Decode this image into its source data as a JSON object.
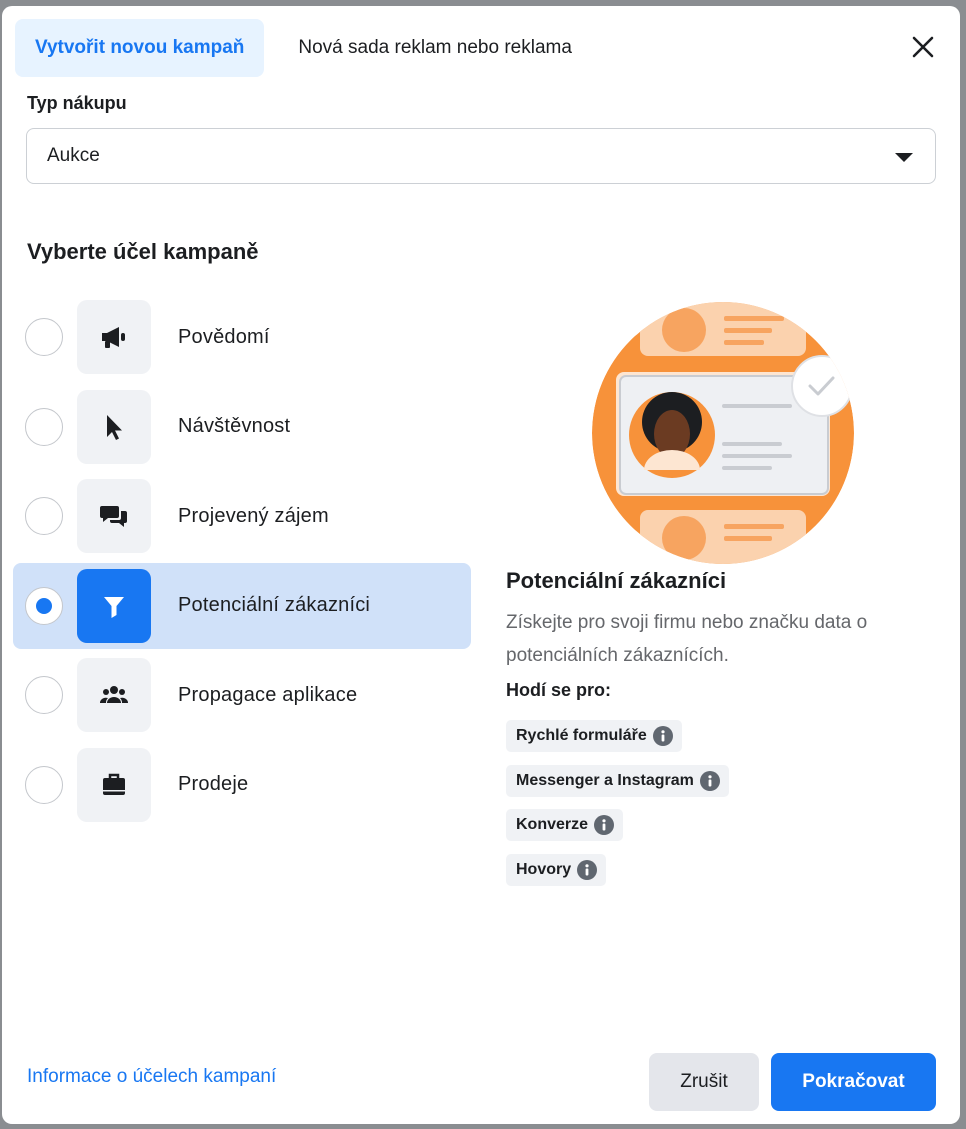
{
  "tabs": {
    "active_label": "Vytvořit novou kampaň",
    "secondary_label": "Nová sada reklam nebo reklama"
  },
  "purchase_type": {
    "label": "Typ nákupu",
    "value": "Aukce"
  },
  "objective_section": {
    "title": "Vyberte účel kampaně",
    "items": [
      {
        "label": "Povědomí",
        "icon": "megaphone-icon",
        "selected": false
      },
      {
        "label": "Návštěvnost",
        "icon": "cursor-icon",
        "selected": false
      },
      {
        "label": "Projevený zájem",
        "icon": "chat-bubbles-icon",
        "selected": false
      },
      {
        "label": "Potenciální zákazníci",
        "icon": "filter-icon",
        "selected": true
      },
      {
        "label": "Propagace aplikace",
        "icon": "people-icon",
        "selected": false
      },
      {
        "label": "Prodeje",
        "icon": "briefcase-icon",
        "selected": false
      }
    ]
  },
  "detail": {
    "title": "Potenciální zákazníci",
    "description": "Získejte pro svoji firmu nebo značku data o potenciálních zákaznících.",
    "good_for_label": "Hodí se pro:",
    "chips": [
      "Rychlé formuláře",
      "Messenger a Instagram",
      "Konverze",
      "Hovory"
    ]
  },
  "footer": {
    "learn_link": "Informace o účelech kampaní",
    "cancel_label": "Zrušit",
    "continue_label": "Pokračovat"
  },
  "colors": {
    "accent": "#1877f2",
    "accent_light": "#e7f3ff",
    "selected_row": "#d0e1f9",
    "illustration_orange": "#f7923a"
  }
}
